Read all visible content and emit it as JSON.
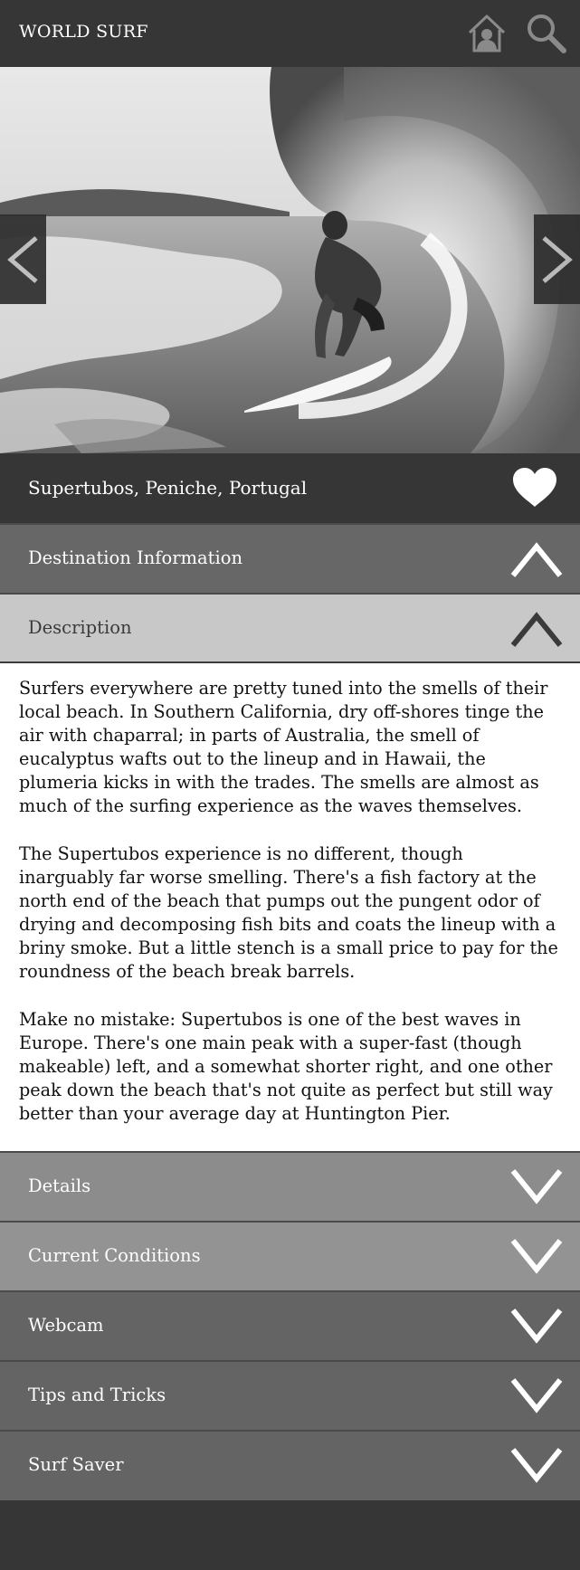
{
  "header": {
    "brand": "WORLD SURF",
    "home_icon": "home-user-icon",
    "search_icon": "search-icon"
  },
  "hero": {
    "image": "surfer-barrel-photo",
    "prev_icon": "chevron-left-icon",
    "next_icon": "chevron-right-icon"
  },
  "location": {
    "title": "Supertubos, Peniche, Portugal",
    "favorite_icon": "heart-icon"
  },
  "sections": {
    "destination": {
      "label": "Destination Information",
      "icon": "chevron-up-icon"
    },
    "description": {
      "label": "Description",
      "icon": "chevron-up-icon"
    },
    "details": {
      "label": "Details",
      "icon": "chevron-down-icon"
    },
    "conditions": {
      "label": "Current Conditions",
      "icon": "chevron-down-icon"
    },
    "webcam": {
      "label": "Webcam",
      "icon": "chevron-down-icon"
    },
    "tips": {
      "label": "Tips and Tricks",
      "icon": "chevron-down-icon"
    },
    "saver": {
      "label": "Surf Saver",
      "icon": "chevron-down-icon"
    }
  },
  "description": {
    "paragraphs": [
      "Surfers everywhere are pretty tuned into the smells of their local beach. In Southern California, dry off-shores tinge the air with chaparral; in parts of Australia, the smell of eucalyptus wafts out to the lineup and in Hawaii, the plumeria kicks in with the trades. The smells are almost as much of the surfing experience as the waves themselves.",
      "The Supertubos experience is no different, though inarguably far worse smelling. There's a fish factory at the north end of the beach that pumps out the pungent odor of drying and decomposing fish bits and coats the lineup with a briny smoke. But a little stench is a small price to pay for the roundness of the beach break barrels.",
      "Make no mistake: Supertubos is one of the best waves in Europe. There's one main peak with a super-fast (though makeable) left, and a somewhat shorter right, and one other peak down the beach that's not quite as perfect but still way better than your average day at Huntington Pier."
    ]
  },
  "colors": {
    "header_bg": "#363636",
    "destination_bg": "#676767",
    "description_bg": "#c8c8c8",
    "details_bg": "#8c8c8c",
    "conditions_bg": "#939393",
    "dark_section_bg": "#646464",
    "footer_bg": "#363636"
  }
}
